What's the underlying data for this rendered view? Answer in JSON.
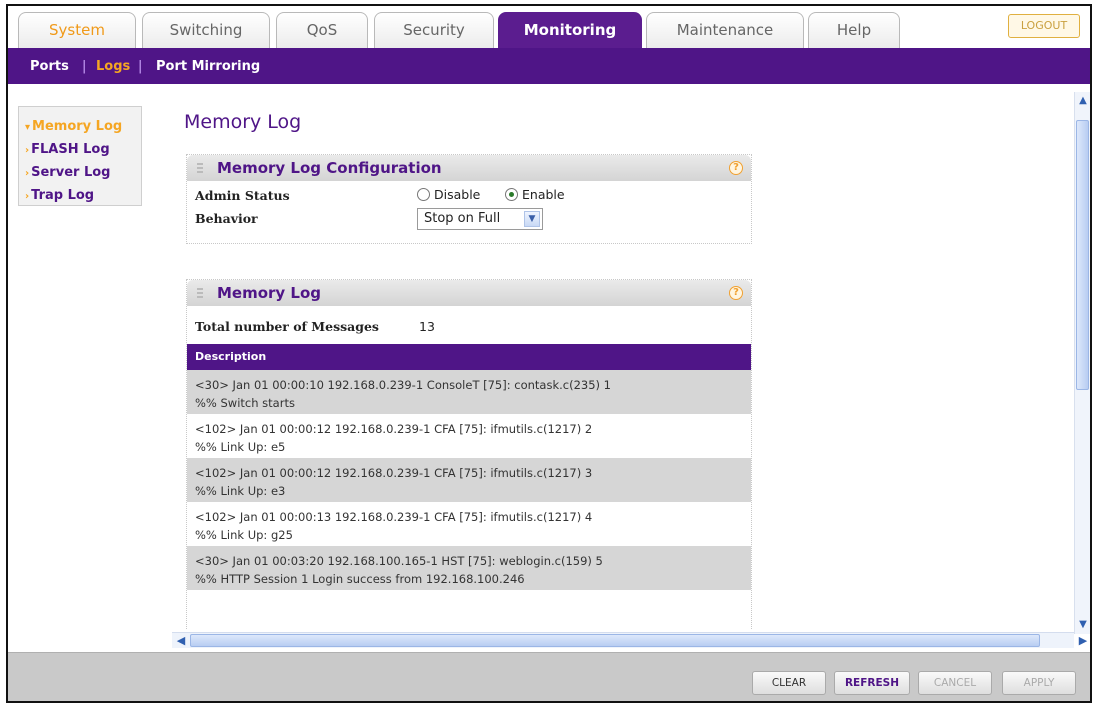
{
  "tabs": [
    {
      "label": "System"
    },
    {
      "label": "Switching"
    },
    {
      "label": "QoS"
    },
    {
      "label": "Security"
    },
    {
      "label": "Monitoring"
    },
    {
      "label": "Maintenance"
    },
    {
      "label": "Help"
    }
  ],
  "logout_label": "LOGOUT",
  "subnav": {
    "ports": "Ports",
    "sep1": "|",
    "logs": "Logs",
    "sep2": "|",
    "port_mirroring": "Port Mirroring"
  },
  "leftmenu": {
    "memory_log": "Memory Log",
    "flash_log": "FLASH Log",
    "server_log": "Server Log",
    "trap_log": "Trap Log"
  },
  "page_title": "Memory Log",
  "config_panel": {
    "title": "Memory Log Configuration",
    "admin_status_label": "Admin Status",
    "disable_label": "Disable",
    "enable_label": "Enable",
    "admin_status_value": "Enable",
    "behavior_label": "Behavior",
    "behavior_value": "Stop on Full"
  },
  "log_panel": {
    "title": "Memory Log",
    "total_label": "Total number of Messages",
    "total_value": "13",
    "description_header": "Description",
    "entries": [
      {
        "line1": "<30> Jan 01 00:00:10 192.168.0.239-1 ConsoleT [75]: contask.c(235) 1",
        "line2": "%% Switch starts"
      },
      {
        "line1": "<102> Jan 01 00:00:12 192.168.0.239-1 CFA [75]: ifmutils.c(1217) 2",
        "line2": "%% Link Up: e5"
      },
      {
        "line1": "<102> Jan 01 00:00:12 192.168.0.239-1 CFA [75]: ifmutils.c(1217) 3",
        "line2": "%% Link Up: e3"
      },
      {
        "line1": "<102> Jan 01 00:00:13 192.168.0.239-1 CFA [75]: ifmutils.c(1217) 4",
        "line2": "%% Link Up: g25"
      },
      {
        "line1": "<30> Jan 01 00:03:20 192.168.100.165-1 HST [75]: weblogin.c(159) 5",
        "line2": "%% HTTP Session 1 Login success from 192.168.100.246"
      }
    ]
  },
  "buttons": {
    "clear": "CLEAR",
    "refresh": "REFRESH",
    "cancel": "CANCEL",
    "apply": "APPLY"
  },
  "icons": {
    "help": "?",
    "scroll_up": "▲",
    "scroll_down": "▼",
    "scroll_left": "◀",
    "scroll_right": "▶",
    "dropdown": "▼",
    "menu_marker": "›"
  }
}
